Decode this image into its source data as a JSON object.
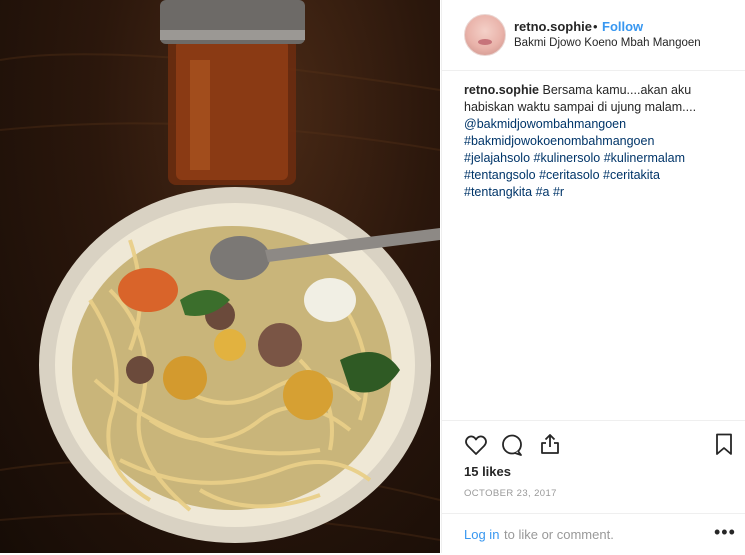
{
  "post": {
    "username": "retno.sophie",
    "separator": "•",
    "follow_label": "Follow",
    "location": "Bakmi Djowo Koeno Mbah Mangoen"
  },
  "caption": {
    "username": "retno.sophie",
    "text": "Bersama kamu....akan aku habiskan waktu sampai di ujung malam....",
    "tags": [
      "@bakmidjowombahmangoen",
      "#bakmidjowokoenombahmangoen",
      "#jelajahsolo",
      "#kulinersolo",
      "#kulinermalam",
      "#tentangsolo",
      "#ceritasolo",
      "#ceritakita",
      "#tentangkita",
      "#a",
      "#r"
    ]
  },
  "actions": {
    "likes": "15 likes",
    "date": "OCTOBER 23, 2017"
  },
  "comment_bar": {
    "login_label": "Log in",
    "rest_text": "to like or comment.",
    "more_label": "•••"
  },
  "icons": {
    "like": "heart-icon",
    "comment": "comment-bubble-icon",
    "share": "share-icon",
    "save": "bookmark-icon",
    "more": "more-options-icon"
  },
  "colors": {
    "link": "#3897f0",
    "hashtag": "#003569",
    "muted": "#999999",
    "text": "#262626"
  }
}
